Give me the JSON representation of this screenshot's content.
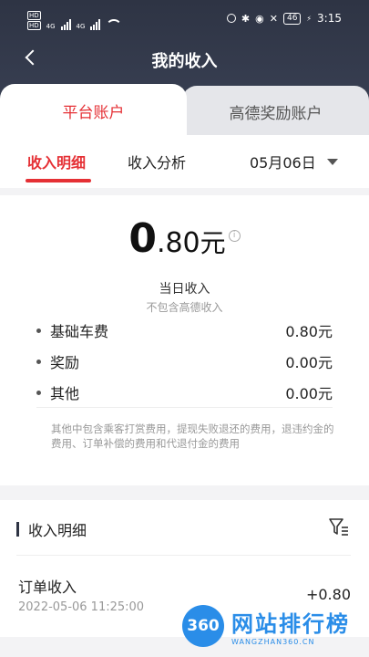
{
  "status_bar": {
    "time": "3:15",
    "battery": "46",
    "network_left": "4G",
    "network_right": "4G",
    "hd_top": "HD",
    "hd_bottom": "HD"
  },
  "header": {
    "title": "我的收入"
  },
  "account_tabs": [
    {
      "label": "平台账户",
      "active": true
    },
    {
      "label": "高德奖励账户",
      "active": false
    }
  ],
  "sub_tabs": {
    "income_detail": "收入明细",
    "income_analysis": "收入分析",
    "date": "05月06日"
  },
  "summary": {
    "amount_int": "0",
    "amount_dec": ".80",
    "unit": "元",
    "info_glyph": "i",
    "label": "当日收入",
    "sublabel": "不包含高德收入"
  },
  "breakdown": [
    {
      "label": "基础车费",
      "value": "0.80元"
    },
    {
      "label": "奖励",
      "value": "0.00元"
    },
    {
      "label": "其他",
      "value": "0.00元"
    }
  ],
  "note": "其他中包含乘客打赏费用，提现失败退还的费用，退违约金的费用、订单补偿的费用和代退付金的费用",
  "detail_section": {
    "title": "收入明细",
    "orders": [
      {
        "name": "订单收入",
        "time": "2022-05-06 11:25:00",
        "amount": "+0.80"
      }
    ]
  },
  "watermark": {
    "badge": "360",
    "main": "网站排行榜",
    "sub": "WANGZHAN360.CN"
  },
  "colors": {
    "accent": "#e53035",
    "header_bg": "#2e3444",
    "watermark": "#2a8de8"
  }
}
